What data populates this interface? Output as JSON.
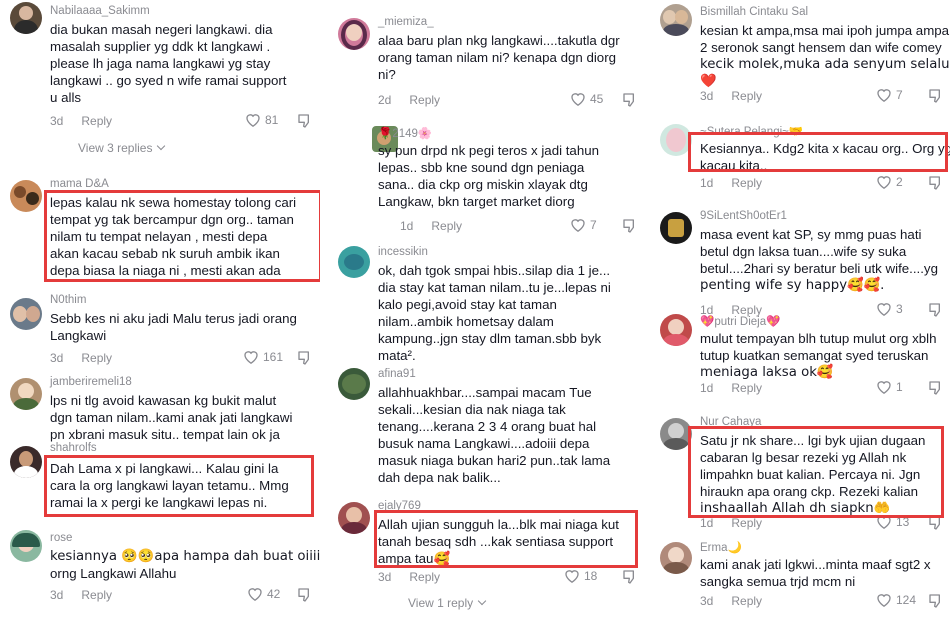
{
  "common": {
    "reply_label": "Reply"
  },
  "col1": [
    {
      "username": "Nabilaaaa_Sakimm",
      "lines": [
        "dia bukan masah negeri langkawi. dia",
        "masalah supplier yg ddk kt langkawi .",
        "please lh jaga nama langkawi yg stay",
        "langkawi .. go syed n wife ramai support",
        "u alls"
      ],
      "time": "3d",
      "likes": "81",
      "view_replies": "View 3 replies"
    },
    {
      "username": "mama D&A",
      "lines": [
        "lepas kalau nk sewa homestay tolong cari",
        "tempat yg tak bercampur dgn org.. taman",
        "nilam tu tempat nelayan , mesti depa",
        "akan kacau sebab nk suruh ambik ikan",
        "depa biasa la niaga ni , mesti akan ada"
      ]
    },
    {
      "username": "N0thim",
      "lines": [
        "Sebb kes ni aku jadi Malu terus jadi orang",
        "Langkawi"
      ],
      "time": "3d",
      "likes": "161"
    },
    {
      "username": "jamberiremeli18",
      "lines": [
        "lps ni tlg avoid kawasan kg bukit malut",
        "dgn taman nilam..kami anak jati langkawi",
        "pn xbrani masuk situ.. tempat lain ok ja"
      ]
    },
    {
      "username": "shahrolfs",
      "lines": [
        "Dah Lama x pi langkawi... Kalau gini la",
        "cara la org langkawi layan tetamu.. Mmg",
        "ramai la x pergi ke langkawi lepas ni."
      ]
    },
    {
      "username": "rose",
      "lines": [
        "kesiannya 🥺🥺apa hampa dah buat oiiii",
        "orng Langkawi Allahu"
      ],
      "time": "3d",
      "likes": "42"
    }
  ],
  "col2": [
    {
      "username": "_miemiza_",
      "lines": [
        "alaa baru plan nkg langkawi....takutla dgr",
        "orang taman nilam ni? kenapa dgn diorg",
        "ni?"
      ],
      "time": "2d",
      "likes": "45"
    },
    {
      "username": "🌹2149🌸",
      "lines": [
        "sy pun drpd nk pegi teros x jadi tahun",
        "lepas.. sbb kne sound dgn peniaga",
        "sana.. dia ckp org miskin xlayak dtg",
        "Langkaw, bkn target market diorg"
      ],
      "time": "1d",
      "likes": "7"
    },
    {
      "username": "incessikin",
      "lines": [
        "ok, dah tgok smpai hbis..silap dia 1 je...",
        "dia stay kat taman nilam..tu je...lepas ni",
        "kalo pegi,avoid stay kat taman",
        "nilam..ambik hometsay dalam",
        "kampung..jgn stay dlm taman.sbb byk",
        "mata²."
      ]
    },
    {
      "username": "afina91",
      "lines": [
        "allahhuakhbar....sampai macam Tue",
        "sekali...kesian dia nak niaga tak",
        "tenang....kerana 2 3 4 orang buat hal",
        "busuk nama Langkawi....adoiii depa",
        "masuk niaga bukan hari2 pun..tak lama",
        "dah depa nak balik..."
      ]
    },
    {
      "username": "ejaly769",
      "lines": [
        "Allah ujian sungguh la...blk mai niaga kut",
        "tanah besaq sdh ...kak sentiasa support",
        "ampa tau🥰"
      ],
      "time": "3d",
      "likes": "18",
      "view_replies": "View 1 reply"
    }
  ],
  "col3": [
    {
      "username": "Bismillah Cintaku Sal",
      "lines": [
        "kesian kt ampa,msa mai ipoh jumpa ampa",
        "2 seronok sangt hensem dan wife comey",
        "kecik molek,muka ada senyum selalu🌹",
        "❤️"
      ],
      "time": "3d",
      "likes": "7"
    },
    {
      "username": "~Sutera Pelangi~🤝",
      "lines": [
        "Kesiannya.. Kdg2 kita x kacau org.. Org yg",
        "kacau kita.."
      ],
      "time": "1d",
      "likes": "2"
    },
    {
      "username": "9SiLentSh0otEr1",
      "lines": [
        "masa event kat SP, sy mmg puas hati",
        "betul dgn laksa tuan....wife sy suka",
        "betul....2hari sy beratur beli utk wife....yg",
        "penting wife sy happy🥰🥰."
      ],
      "time": "1d",
      "likes": "3"
    },
    {
      "username": "💖putri Dieja💖",
      "lines": [
        "mulut tempayan blh tutup mulut org xblh",
        "tutup kuatkan semangat syed teruskan",
        "meniaga laksa ok🥰"
      ],
      "time": "1d",
      "likes": "1"
    },
    {
      "username": "Nur Cahaya",
      "lines": [
        "Satu jr nk share... lgi byk ujian dugaan",
        "cabaran lg besar rezeki yg Allah nk",
        "limpahkn buat kalian. Percaya ni. Jgn",
        "hiraukn apa orang ckp. Rezeki kalian",
        "inshaallah Allah dh siapkn🤲"
      ],
      "time": "1d",
      "likes": "13"
    },
    {
      "username": "Erma🌙",
      "lines": [
        "kami anak jati lgkwi...minta maaf sgt2 x",
        "sangka semua trjd mcm ni"
      ],
      "time": "3d",
      "likes": "124"
    }
  ]
}
